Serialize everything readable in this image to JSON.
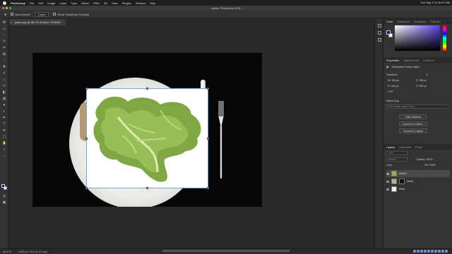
{
  "menubar": {
    "app_name": "Photoshop",
    "items": [
      "File",
      "Edit",
      "Image",
      "Layer",
      "Type",
      "Select",
      "Filter",
      "3D",
      "View",
      "Plugins",
      "Window",
      "Help"
    ],
    "clock": "Sun Sep 4  11:40:57 AM"
  },
  "window": {
    "title": "Adobe Photoshop 2021"
  },
  "options": {
    "auto_select_label": "Auto-Select:",
    "auto_select_value": "Layer",
    "show_transform_label": "Show Transform Controls"
  },
  "document": {
    "tab_label": "plate.png @ 66.7% (lettuce, RGB/8) *"
  },
  "panels": {
    "color_tabs": [
      "Color",
      "Swatches",
      "Gradients",
      "Patterns"
    ],
    "properties_tabs": [
      "Properties",
      "Adjustments",
      "Libraries"
    ],
    "object_type": "Embedded Smart Object",
    "transform_heading": "Transform",
    "w": "W: 181 px",
    "h": "H: 344 px",
    "x": "X: 936 px",
    "y": "Y: 238 px",
    "angle": "0.00°",
    "file_name": "lettuce.png",
    "layer_comp_placeholder": "Don't Apply Layer Comp",
    "edit_contents": "Edit Contents",
    "convert_linked": "Convert to Linked...",
    "convert_layers": "Convert to Layers",
    "layers_tabs": [
      "Layers",
      "Channels",
      "Paths"
    ],
    "kind_filter": "Kind",
    "blend_mode": "Normal",
    "opacity": "Opacity: 100%",
    "lock_label": "Lock:",
    "fill": "Fill: 100%",
    "layers": [
      {
        "name": "lettuce",
        "selected": true
      },
      {
        "name": "bread",
        "selected": false
      },
      {
        "name": "Plate",
        "selected": false
      }
    ]
  },
  "status": {
    "zoom": "66.67%",
    "doc_info": "1463 px x 976 px (72 ppi)"
  }
}
